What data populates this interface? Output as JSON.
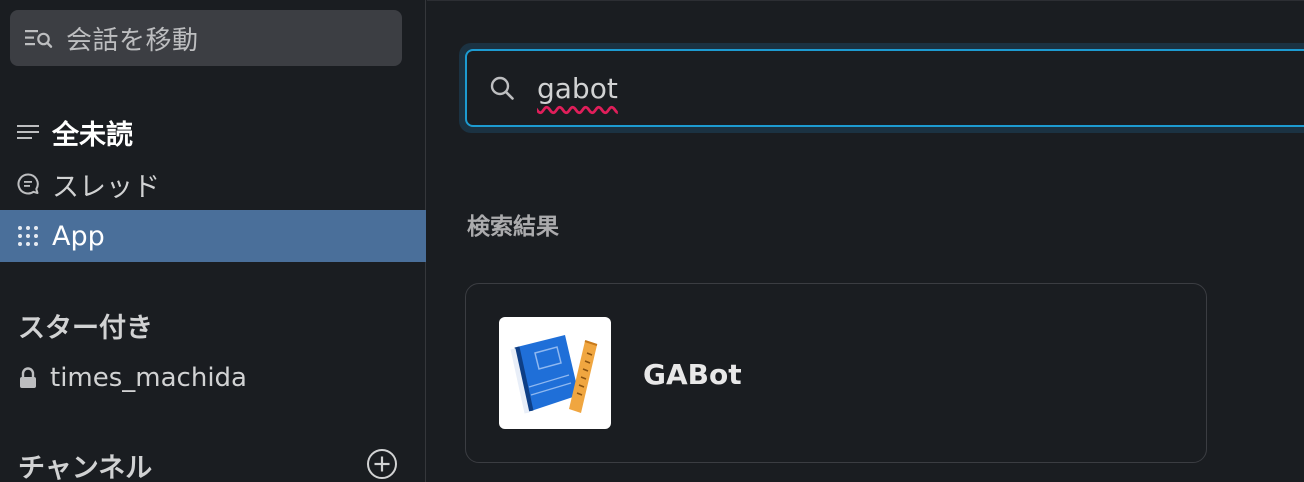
{
  "sidebar": {
    "jump_label": "会話を移動",
    "nav": [
      {
        "label": "全未読"
      },
      {
        "label": "スレッド"
      },
      {
        "label": "App"
      }
    ],
    "starred_title": "スター付き",
    "starred_channel": "times_machida",
    "channels_title": "チャンネル"
  },
  "main": {
    "search_value": "gabot",
    "results_heading": "検索結果",
    "result": {
      "name": "GABot"
    }
  },
  "colors": {
    "active_item": "#4a6f9a",
    "search_focus": "#1d9bd1",
    "book_blue": "#1f6fd8"
  }
}
